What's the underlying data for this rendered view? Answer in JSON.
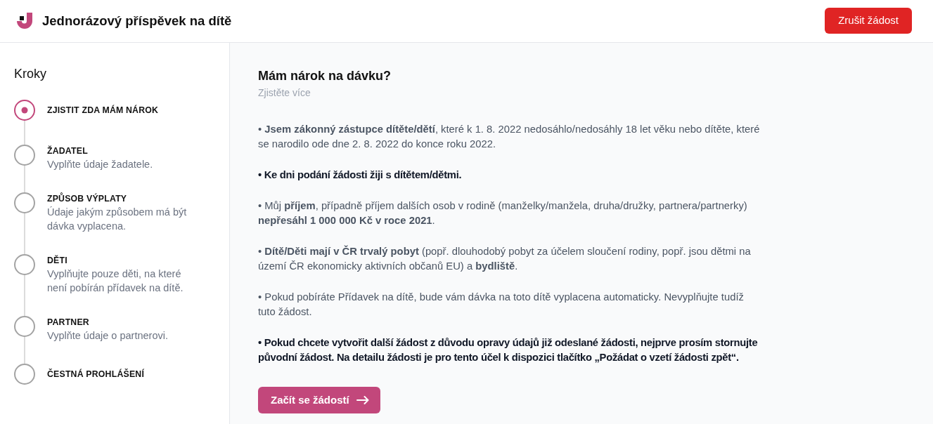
{
  "header": {
    "title": "Jednorázový příspěvek na dítě",
    "cancel_button": "Zrušit žádost"
  },
  "sidebar": {
    "title": "Kroky",
    "steps": [
      {
        "label": "ZJISTIT ZDA MÁM NÁROK",
        "selected": true
      },
      {
        "label": "ŽADATEL",
        "description": "Vyplňte údaje žadatele.",
        "selected": false
      },
      {
        "label": "ZPŮSOB VÝPLATY",
        "description": "Údaje jakým způsobem má být dávka vyplacena.",
        "selected": false
      },
      {
        "label": "DĚTI",
        "description": "Vyplňujte pouze děti, na které není pobírán přídavek na dítě.",
        "selected": false
      },
      {
        "label": "PARTNER",
        "description": "Vyplňte údaje o partnerovi.",
        "selected": false
      },
      {
        "label": "ČESTNÁ PROHLÁŠENÍ",
        "selected": false
      }
    ]
  },
  "main": {
    "title": "Mám nárok na dávku?",
    "subtitle": "Zjistěte více",
    "paragraphs": [
      {
        "text": "• **Jsem zákonný zástupce dítěte/dětí**, které k 1. 8. 2022 nedosáhlo/nedosáhly 18 let věku nebo dítěte, které se narodilo ode dne 2. 8. 2022 do konce roku 2022.",
        "bold": false
      },
      {
        "text": "• Ke dni podání žádosti žiji s dítětem/dětmi.",
        "bold": true
      },
      {
        "text": "• Můj **příjem**, případně příjem dalších osob v rodině (manželky/manžela, druha/družky, partnera/partnerky) **nepřesáhl 1 000 000 Kč v roce 2021**.",
        "bold": false
      },
      {
        "text": "• **Dítě/Děti mají v ČR trvalý pobyt** (popř. dlouhodobý pobyt za účelem sloučení rodiny, popř. jsou dětmi na území ČR ekonomicky aktivních občanů EU) a **bydliště**.",
        "bold": false
      },
      {
        "text": "• Pokud pobíráte Přídavek na dítě, bude vám dávka na toto dítě vyplacena automaticky. Nevyplňujte tudíž tuto žádost.",
        "bold": false
      },
      {
        "text": "• Pokud chcete vytvořit další žádost z důvodu opravy údajů již odeslané žádosti, nejprve prosím stornujte původní žádost. Na detailu žádosti je pro tento účel k dispozici tlačítko „Požádat o vzetí žádosti zpět“.",
        "bold": true
      }
    ],
    "start_button": "Začít se žádostí"
  }
}
